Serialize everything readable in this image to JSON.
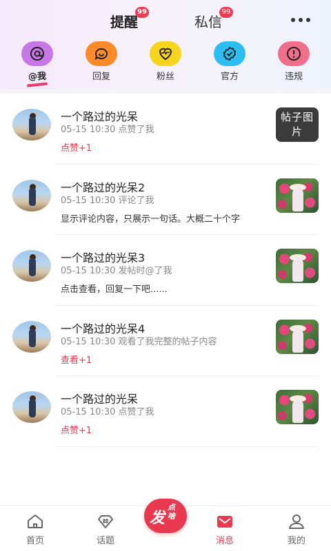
{
  "header": {
    "tabs": [
      {
        "label": "提醒",
        "badge": "99",
        "active": true
      },
      {
        "label": "私信",
        "badge": "99",
        "active": false
      }
    ],
    "more_icon": "more-horizontal-icon"
  },
  "categories": [
    {
      "label": "@我",
      "icon": "at-icon",
      "color": "#c778e6",
      "active": true
    },
    {
      "label": "回复",
      "icon": "smile-chat-icon",
      "color": "#ff8a2a",
      "active": false
    },
    {
      "label": "粉丝",
      "icon": "heart-pulse-icon",
      "color": "#f7d51e",
      "active": false
    },
    {
      "label": "官方",
      "icon": "official-badge-icon",
      "color": "#2ebdf0",
      "active": false
    },
    {
      "label": "违规",
      "icon": "warning-icon",
      "color": "#f26f8c",
      "active": false
    }
  ],
  "notifications": [
    {
      "nickname": "一个路过的光呆",
      "time": "05-15 10:30",
      "event": "点赞了我",
      "detail": "点赞+1",
      "detail_style": "red",
      "thumb_text": "帖子图片"
    },
    {
      "nickname": "一个路过的光呆2",
      "time": "05-15 10:30",
      "event": "评论了我",
      "detail": "显示评论内容，只展示一句话。大概二十个字",
      "detail_style": "normal",
      "thumb_text": ""
    },
    {
      "nickname": "一个路过的光呆3",
      "time": "05-15 10:30",
      "event": "发帖时@了我",
      "detail": "点击查看，回复一下吧......",
      "detail_style": "normal",
      "thumb_text": ""
    },
    {
      "nickname": "一个路过的光呆4",
      "time": "05-15 10:30",
      "event": "观看了我完整的帖子内容",
      "detail": "查看+1",
      "detail_style": "red",
      "thumb_text": ""
    },
    {
      "nickname": "一个路过的光呆",
      "time": "05-15 10:30",
      "event": "点赞了我",
      "detail": "点赞+1",
      "detail_style": "red",
      "thumb_text": ""
    }
  ],
  "bottom_nav": {
    "items": [
      {
        "label": "首页",
        "icon": "home-icon",
        "active": false
      },
      {
        "label": "话题",
        "icon": "topic-diamond-icon",
        "active": false
      },
      {
        "label": "消息",
        "icon": "message-icon",
        "active": true
      },
      {
        "label": "我的",
        "icon": "profile-icon",
        "active": false
      }
    ],
    "post_button": {
      "big": "发",
      "small": "点啥"
    }
  },
  "colors": {
    "accent": "#e8394f",
    "badge": "#ef3b4f"
  }
}
